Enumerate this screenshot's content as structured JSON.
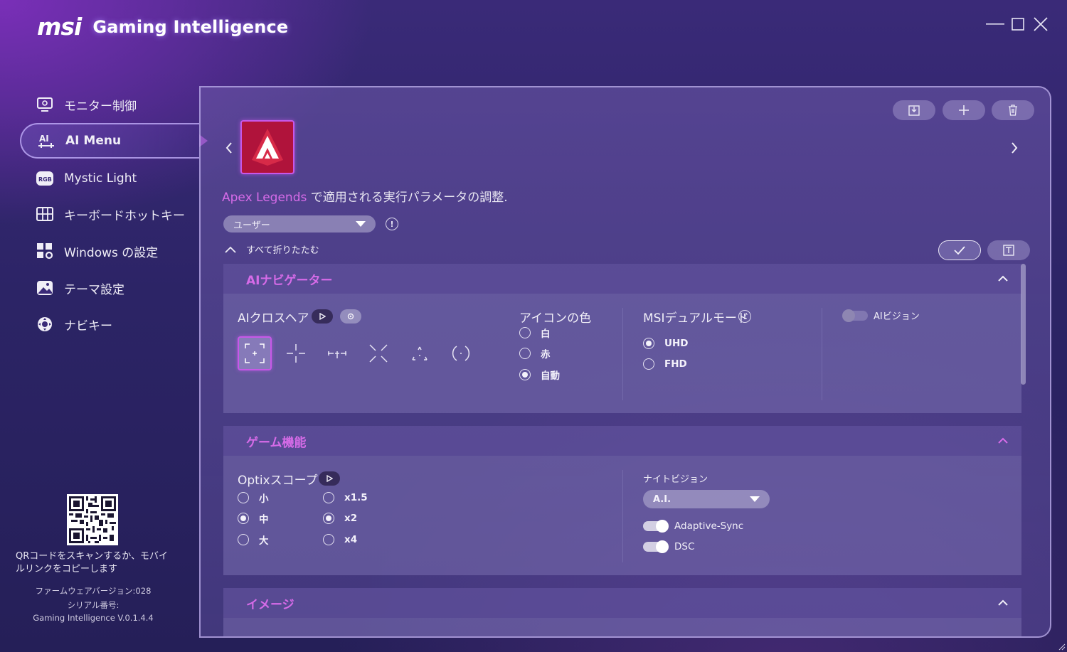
{
  "app": {
    "brand": "msi",
    "title": "Gaming Intelligence"
  },
  "window": {
    "minimize": "minimize",
    "maximize": "maximize",
    "close": "close"
  },
  "sidebar": {
    "items": [
      {
        "label": "モニター制御",
        "icon": "monitor-icon"
      },
      {
        "label": "AI Menu",
        "icon": "ai-icon",
        "active": true
      },
      {
        "label": "Mystic Light",
        "icon": "rgb-icon"
      },
      {
        "label": "キーボードホットキー",
        "icon": "keyboard-icon"
      },
      {
        "label": "Windows の設定",
        "icon": "windows-settings-icon"
      },
      {
        "label": "テーマ設定",
        "icon": "theme-icon"
      },
      {
        "label": "ナビキー",
        "icon": "navi-key-icon"
      }
    ],
    "rgb_badge": "RGB",
    "qr_caption": "QRコードをスキャンするか、モバイルリンクをコピーします",
    "firmware": "ファームウェアバージョン:028",
    "serial": "シリアル番号:",
    "version": "Gaming Intelligence V.0.1.4.4"
  },
  "main": {
    "game_name": "Apex Legends",
    "heading_suffix": " で適用される実行パラメータの調整.",
    "profile_select": "ユーザー",
    "collapse_all": "すべて折りたたむ",
    "accent_color": "#d66be8",
    "sections": {
      "ai_navigator": {
        "title": "AIナビゲーター",
        "crosshair_label": "AIクロスヘア",
        "icon_color_label": "アイコンの色",
        "icon_colors": [
          "白",
          "赤",
          "自動"
        ],
        "icon_color_selected": "自動",
        "dual_mode_label": "MSIデュアルモード",
        "dual_modes": [
          "UHD",
          "FHD"
        ],
        "dual_mode_selected": "UHD",
        "ai_vision_label": "AIビジョン"
      },
      "game_features": {
        "title": "ゲーム機能",
        "optix_label": "Optixスコープ",
        "sizes": [
          "小",
          "中",
          "大"
        ],
        "size_selected": "中",
        "zooms": [
          "x1.5",
          "x2",
          "x4"
        ],
        "zoom_selected": "x2",
        "night_vision_label": "ナイトビジョン",
        "night_vision_value": "A.I.",
        "adaptive_sync_label": "Adaptive-Sync",
        "dsc_label": "DSC"
      },
      "image": {
        "title": "イメージ"
      }
    }
  }
}
